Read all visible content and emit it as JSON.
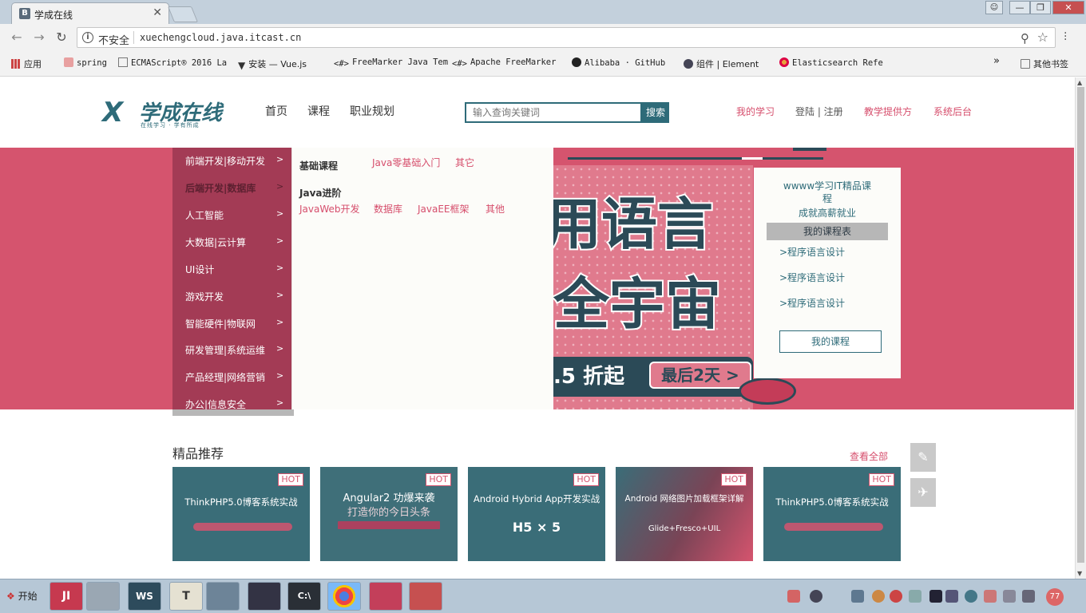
{
  "browser": {
    "tab_title": "学成在线",
    "tab_favicon": "B",
    "tab_close": "✕",
    "security_label": "不安全",
    "url": "xuechengcloud.java.itcast.cn",
    "window_controls": [
      "—",
      "❐",
      "✕"
    ],
    "bookmarks": [
      {
        "label": "应用",
        "icon": "apps-icon"
      },
      {
        "label": "spring",
        "icon": "page-icon"
      },
      {
        "label": "ECMAScript® 2016 La",
        "icon": "page-icon"
      },
      {
        "label": "安装 — Vue.js",
        "icon": "vue-icon"
      },
      {
        "label": "FreeMarker Java Tem",
        "icon": "code-icon"
      },
      {
        "label": "Apache FreeMarker",
        "icon": "code-icon"
      },
      {
        "label": "Alibaba · GitHub",
        "icon": "github-icon"
      },
      {
        "label": "组件 | Element",
        "icon": "element-icon"
      },
      {
        "label": "Elasticsearch Refe",
        "icon": "elastic-icon"
      }
    ],
    "bookmarks_more": "»",
    "other_bookmarks": "其他书签"
  },
  "header": {
    "logo_mark": "X",
    "logo_text": "学成在线",
    "logo_sub": "在线学习 · 学有所成",
    "nav": [
      "首页",
      "课程",
      "职业规划"
    ],
    "search_placeholder": "输入查询关键词",
    "search_button": "搜索",
    "links": {
      "my_learning": "我的学习",
      "login_register": "登陆 | 注册",
      "teaching_provider": "教学提供方",
      "admin": "系统后台"
    }
  },
  "category_menu": [
    {
      "label": "前端开发|移动开发",
      "arrow": ">"
    },
    {
      "label": "后端开发|数据库",
      "arrow": ">"
    },
    {
      "label": "人工智能",
      "arrow": ">"
    },
    {
      "label": "大数据|云计算",
      "arrow": ">"
    },
    {
      "label": "UI设计",
      "arrow": ">"
    },
    {
      "label": "游戏开发",
      "arrow": ">"
    },
    {
      "label": "智能硬件|物联网",
      "arrow": ">"
    },
    {
      "label": "研发管理|系统运维",
      "arrow": ">"
    },
    {
      "label": "产品经理|网络营销",
      "arrow": ">"
    },
    {
      "label": "办公|信息安全",
      "arrow": ">"
    }
  ],
  "sub_menu": {
    "group1_title": "基础课程",
    "group1_links": [
      "Java零基础入门",
      "其它"
    ],
    "group2_title": "Java进阶",
    "group2_links": [
      "JavaWeb开发",
      "数据库",
      "JavaEE框架",
      "其他"
    ]
  },
  "hero": {
    "line1": "用语言",
    "line2": "全宇宙",
    "discount": ".5 折起",
    "last_days": "最后2天 >"
  },
  "side_card": {
    "line1": "wwww学习IT精品课",
    "line2": "程",
    "line3": "成就高薪就业",
    "table_head": "我的课程表",
    "items": [
      ">程序语言设计",
      ">程序语言设计",
      ">程序语言设计"
    ],
    "button": "我的课程"
  },
  "recommend": {
    "title": "精品推荐",
    "see_all": "查看全部",
    "cards": [
      {
        "title": "ThinkPHP5.0博客系统实战",
        "hot": "HOT"
      },
      {
        "title": "Angular2 功爆来袭",
        "hot": "HOT"
      },
      {
        "title": "Android Hybrid App开发实战",
        "hot": "HOT"
      },
      {
        "title": "Android 网络图片加载框架详解",
        "hot": "HOT"
      },
      {
        "title": "ThinkPHP5.0博客系统实战",
        "hot": "HOT"
      }
    ],
    "card2_sub": "打造你的今日头条",
    "card3_sub": "H5 × 5",
    "card4_sub": "Glide+Fresco+UIL"
  },
  "taskbar": {
    "start": "开始",
    "apps": [
      "JI",
      "",
      "WS",
      "T",
      "",
      "",
      "C:\\",
      "",
      "",
      ""
    ],
    "tray_badge": "77"
  }
}
